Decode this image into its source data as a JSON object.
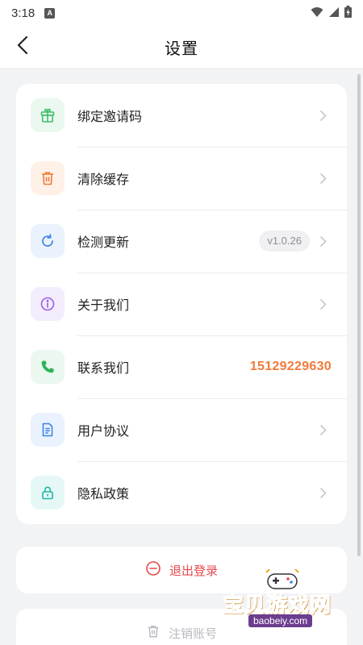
{
  "status_bar": {
    "time": "3:18",
    "notification_badge": "A",
    "icons": [
      "wifi-icon",
      "signal-icon",
      "battery-icon"
    ]
  },
  "nav": {
    "title": "设置",
    "back_icon": "chevron-left-icon"
  },
  "settings": {
    "items": [
      {
        "label": "绑定邀请码",
        "icon": "gift-icon",
        "icon_color": "#3fbf6b",
        "icon_bg": "#eaf8ef"
      },
      {
        "label": "清除缓存",
        "icon": "trash-icon",
        "icon_color": "#f07a3a",
        "icon_bg": "#fff1e8"
      },
      {
        "label": "检测更新",
        "icon": "refresh-icon",
        "icon_color": "#3f84e5",
        "icon_bg": "#eaf2fd",
        "badge": "v1.0.26"
      },
      {
        "label": "关于我们",
        "icon": "info-icon",
        "icon_color": "#9b5de5",
        "icon_bg": "#f3ecfd"
      },
      {
        "label": "联系我们",
        "icon": "phone-icon",
        "icon_color": "#2fb35a",
        "icon_bg": "#eaf8ef",
        "value": "15129229630"
      },
      {
        "label": "用户协议",
        "icon": "document-icon",
        "icon_color": "#3f84e5",
        "icon_bg": "#eaf2fd"
      },
      {
        "label": "隐私政策",
        "icon": "lock-icon",
        "icon_color": "#1fb6a8",
        "icon_bg": "#e6f8f6"
      }
    ]
  },
  "actions": {
    "logout_label": "退出登录",
    "logout_color": "#e5484d",
    "cancel_account_label": "注销账号",
    "cancel_color": "#b7bac0"
  },
  "watermark": {
    "text": "宝贝游戏网",
    "domain": "baobeiy.com"
  }
}
